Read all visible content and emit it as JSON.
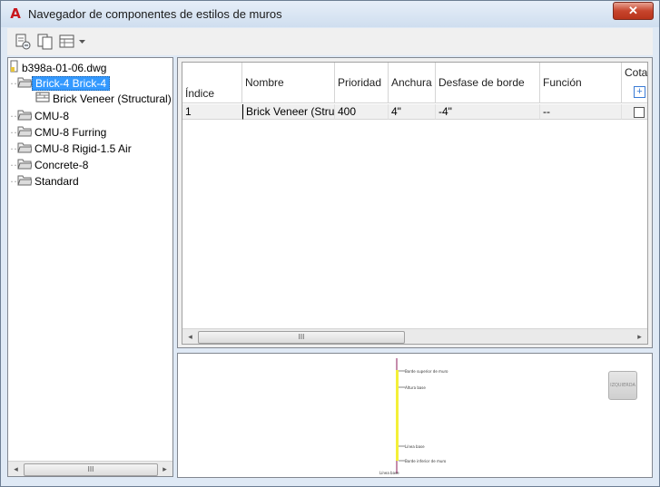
{
  "window": {
    "title": "Navegador de componentes de estilos de muros",
    "close_glyph": "✕",
    "app_icon_glyph": "A"
  },
  "toolbar": {
    "buttons": [
      "new-component-icon",
      "copy-component-icon",
      "table-view-icon",
      "dropdown-arrow-icon"
    ]
  },
  "tree": {
    "root": "b398a-01-06.dwg",
    "items": [
      {
        "label": "Brick-4 Brick-4",
        "selected": true
      },
      {
        "label": "Brick Veneer (Structural)",
        "child": true
      },
      {
        "label": "CMU-8"
      },
      {
        "label": "CMU-8 Furring"
      },
      {
        "label": "CMU-8 Rigid-1.5 Air"
      },
      {
        "label": "Concrete-8"
      },
      {
        "label": "Standard"
      }
    ]
  },
  "grid": {
    "columns": {
      "indice": "Índice",
      "nombre": "Nombre",
      "prioridad": "Prioridad",
      "anchura": "Anchura",
      "desfase": "Desfase de borde",
      "funcion": "Función",
      "cota": "Cota"
    },
    "rows": [
      {
        "indice": "1",
        "nombre": "Brick Veneer (Stru...",
        "prioridad": "400",
        "anchura": "4\"",
        "desfase": "-4\"",
        "funcion": "--"
      }
    ],
    "add_glyph": "+",
    "scroll_grip": "III"
  },
  "tree_scroll": {
    "grip": "III"
  },
  "preview": {
    "side_button": "IZQUIERDA",
    "labels": [
      "Borde superior de muro",
      "Altura base",
      "Línea base",
      "Borde inferior de muro",
      "Línea base"
    ]
  },
  "scroll_arrows": {
    "left": "◂",
    "right": "▸"
  },
  "colors": {
    "selection": "#3399ff",
    "accent_yellow": "#f4f038",
    "close_red": "#c7452d",
    "autocad_red": "#c8161d"
  }
}
